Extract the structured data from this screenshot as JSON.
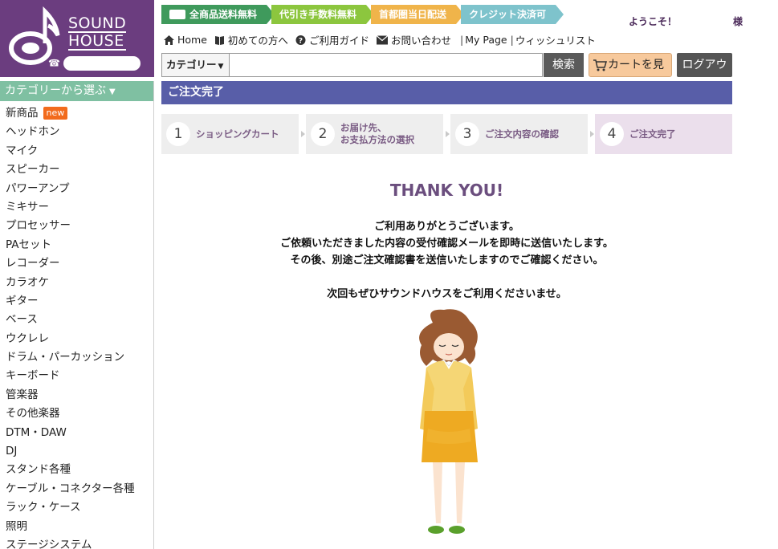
{
  "brand": {
    "line1": "SOUND",
    "line2": "HOUSE",
    "phone_icon": "phone-icon"
  },
  "badges": [
    {
      "label": "全商品送料無料",
      "color": "#3f9a5c",
      "icon": "truck-icon"
    },
    {
      "label": "代引き手数料無料",
      "color": "#8cc63e"
    },
    {
      "label": "首都圏当日配送",
      "color": "#f0b44a"
    },
    {
      "label": "クレジット決済可",
      "color": "#7ec3cc"
    }
  ],
  "welcome": {
    "prefix": "ようこそ！",
    "suffix": "様"
  },
  "toplinks": {
    "home": "Home",
    "first_time": "初めての方へ",
    "guide": "ご利用ガイド",
    "contact": "お問い合わせ",
    "mypage": "My Page",
    "wishlist": "ウィッシュリスト"
  },
  "search": {
    "category_label": "カテゴリー",
    "value": "",
    "button": "検索"
  },
  "header_buttons": {
    "cart": "カートを見る",
    "logout": "ログアウト"
  },
  "sidebar": {
    "heading": "カテゴリーから選ぶ",
    "new_badge": "new",
    "items": [
      "新商品",
      "ヘッドホン",
      "マイク",
      "スピーカー",
      "パワーアンプ",
      "ミキサー",
      "プロセッサー",
      "PAセット",
      "レコーダー",
      "カラオケ",
      "ギター",
      "ベース",
      "ウクレレ",
      "ドラム・パーカッション",
      "キーボード",
      "管楽器",
      "その他楽器",
      "DTM・DAW",
      "DJ",
      "スタンド各種",
      "ケーブル・コネクター各種",
      "ラック・ケース",
      "照明",
      "ステージシステム"
    ]
  },
  "page_title": "ご注文完了",
  "steps": [
    {
      "num": "1",
      "label": "ショッピングカート"
    },
    {
      "num": "2",
      "label": "お届け先、\nお支払方法の選択"
    },
    {
      "num": "3",
      "label": "ご注文内容の確認"
    },
    {
      "num": "4",
      "label": "ご注文完了"
    }
  ],
  "active_step": 4,
  "thank_you": "THANK YOU!",
  "message_lines": [
    "ご利用ありがとうございます。",
    "ご依頼いただきました内容の受付確認メールを即時に送信いたします。",
    "その後、別途ご注文確認書を送信いたしますのでご確認ください。"
  ],
  "closing": "次回もぜひサウンドハウスをご利用くださいませ。",
  "colors": {
    "brand_purple": "#6b3d7f",
    "title_bar": "#585ea8",
    "sidebar_head": "#7fc0a2",
    "cart_button": "#f7c99c",
    "thank_you": "#6b4e7e"
  }
}
